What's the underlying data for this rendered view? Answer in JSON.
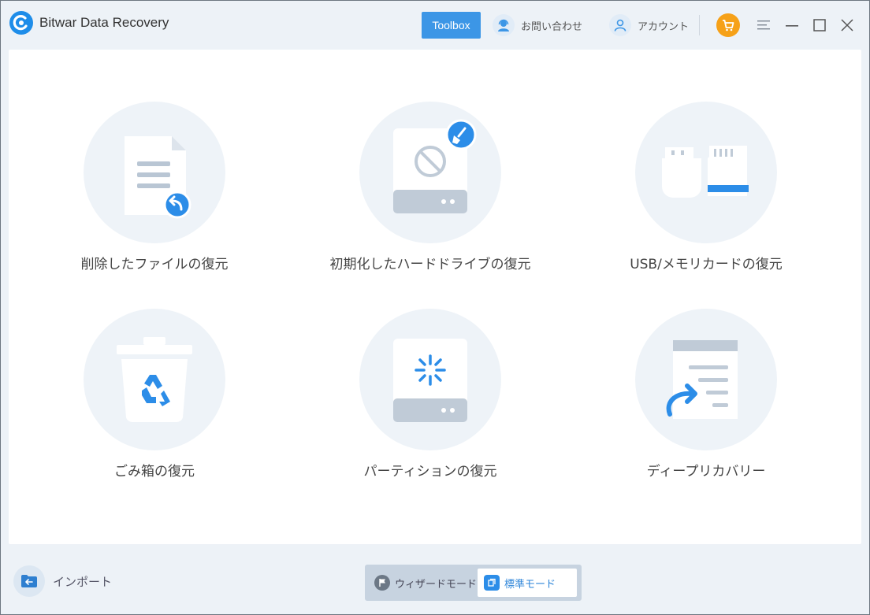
{
  "window": {
    "title": "Bitwar Data Recovery",
    "accent": "#1e8de9"
  },
  "toolbar": {
    "toolbox_label": "Toolbox",
    "contact_label": "お問い合わせ",
    "account_label": "アカウント"
  },
  "cards": [
    {
      "label": "削除したファイルの復元",
      "icon": "deleted-file-icon"
    },
    {
      "label": "初期化したハードドライブの復元",
      "icon": "formatted-drive-icon"
    },
    {
      "label": "USB/メモリカードの復元",
      "icon": "usb-memory-card-icon"
    },
    {
      "label": "ごみ箱の復元",
      "icon": "recycle-bin-icon"
    },
    {
      "label": "パーティションの復元",
      "icon": "partition-icon"
    },
    {
      "label": "ディープリカバリー",
      "icon": "deep-recovery-icon"
    }
  ],
  "bottom": {
    "import_label": "インポート",
    "wizard_mode_label": "ウィザードモード",
    "standard_mode_label": "標準モード",
    "selected_mode": "標準モード"
  }
}
